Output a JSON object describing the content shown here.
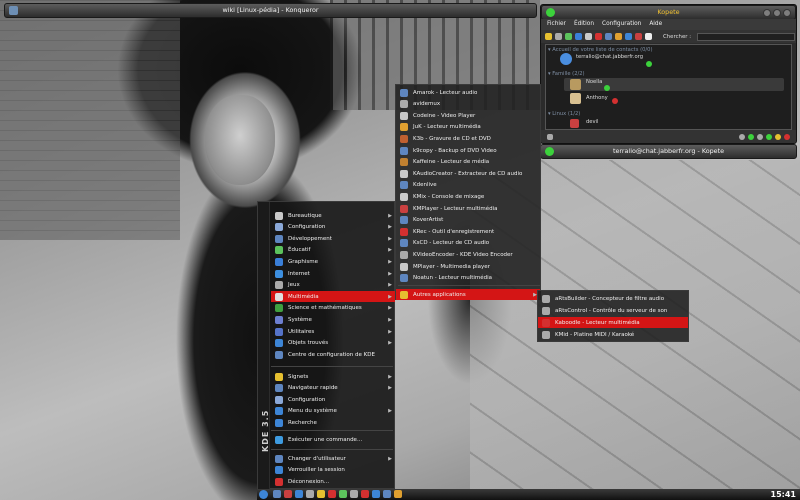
{
  "konqueror": {
    "title": "wiki [Linux-pédia] - Konqueror"
  },
  "kopete": {
    "title": "Kopete",
    "menu": [
      "Fichier",
      "Édition",
      "Configuration",
      "Aide"
    ],
    "search_label": "Chercher :",
    "contacts": [
      {
        "label": "Accueil de votre liste de contacts (0/0)",
        "type": "group"
      },
      {
        "label": "terralio@chat.jabberfr.org",
        "type": "contact"
      },
      {
        "label": "Famille (2/2)",
        "type": "group"
      },
      {
        "label": "Noella",
        "type": "contact"
      },
      {
        "label": "Anthony",
        "type": "contact"
      },
      {
        "label": "Linux (1/2)",
        "type": "group"
      },
      {
        "label": "devil",
        "type": "contact"
      }
    ],
    "colors": {
      "accent": "#f0c030",
      "status_green": "#3cd23c"
    }
  },
  "chat": {
    "title": "terralio@chat.jabberfr.org - Kopete"
  },
  "kmenu": {
    "brand": "KDE 3.5",
    "categories": [
      {
        "label": "Bureautique",
        "icon": "office-icon",
        "color": "#c9c9c9"
      },
      {
        "label": "Configuration",
        "icon": "wrench-icon",
        "color": "#8aa8d8"
      },
      {
        "label": "Développement",
        "icon": "gear-icon",
        "color": "#5e86c0"
      },
      {
        "label": "Éducatif",
        "icon": "education-icon",
        "color": "#5cc35c"
      },
      {
        "label": "Graphisme",
        "icon": "paint-icon",
        "color": "#3a7fd8"
      },
      {
        "label": "Internet",
        "icon": "globe-icon",
        "color": "#3d8fe0"
      },
      {
        "label": "Jeux",
        "icon": "games-icon",
        "color": "#aaaaaa"
      },
      {
        "label": "Multimédia",
        "icon": "multimedia-icon",
        "color": "#e0e0e0"
      },
      {
        "label": "Science et mathématiques",
        "icon": "science-icon",
        "color": "#40a040"
      },
      {
        "label": "Système",
        "icon": "system-icon",
        "color": "#6d7fd1"
      },
      {
        "label": "Utilitaires",
        "icon": "utilities-icon",
        "color": "#5573c9"
      },
      {
        "label": "Objets trouvés",
        "icon": "lost-found-icon",
        "color": "#3d85d6"
      },
      {
        "label": "Centre de configuration de KDE",
        "icon": "kcontrol-icon",
        "color": "#5e86c0"
      }
    ],
    "actions": [
      {
        "label": "Signets",
        "icon": "bookmark-icon",
        "color": "#e6c030"
      },
      {
        "label": "Navigateur rapide",
        "icon": "quickbrowser-icon",
        "color": "#5e86c0"
      },
      {
        "label": "Configuration",
        "icon": "wrench-icon",
        "color": "#8aa8d8"
      },
      {
        "label": "Menu du système",
        "icon": "computer-icon",
        "color": "#3d85d6"
      },
      {
        "label": "Recherche",
        "icon": "search-icon",
        "color": "#3d85d6"
      }
    ],
    "run": {
      "label": "Exécuter une commande...",
      "icon": "run-icon",
      "color": "#3d9be0"
    },
    "session": [
      {
        "label": "Changer d'utilisateur",
        "icon": "switch-user-icon",
        "color": "#5e86c0"
      },
      {
        "label": "Verrouiller la session",
        "icon": "lock-icon",
        "color": "#3d85d6"
      },
      {
        "label": "Déconnexion...",
        "icon": "logout-icon",
        "color": "#d43030"
      }
    ]
  },
  "multimedia_menu": [
    {
      "label": "Amarok - Lecteur audio",
      "color": "#5e86c0"
    },
    {
      "label": "avidemux",
      "color": "#aaaaaa"
    },
    {
      "label": "Codeine - Video Player",
      "color": "#c9c9c9"
    },
    {
      "label": "JuK - Lecteur multimédia",
      "color": "#e0a030"
    },
    {
      "label": "K3b - Gravure de CD et DVD",
      "color": "#c06030"
    },
    {
      "label": "k9copy - Backup of DVD Video",
      "color": "#5e86c0"
    },
    {
      "label": "Kaffeine - Lecteur de média",
      "color": "#c08030"
    },
    {
      "label": "KAudioCreator - Extracteur de CD audio",
      "color": "#c9c9c9"
    },
    {
      "label": "Kdenlive",
      "color": "#5e86c0"
    },
    {
      "label": "KMix - Console de mixage",
      "color": "#c9c9c9"
    },
    {
      "label": "KMPlayer - Lecteur multimédia",
      "color": "#c94040"
    },
    {
      "label": "KoverArtist",
      "color": "#5e86c0"
    },
    {
      "label": "KRec - Outil d'enregistrement",
      "color": "#d43030"
    },
    {
      "label": "KsCD - Lecteur de CD audio",
      "color": "#5e86c0"
    },
    {
      "label": "KVideoEncoder - KDE Video Encoder",
      "color": "#aaaaaa"
    },
    {
      "label": "MPlayer - Multimedia player",
      "color": "#c9c9c9"
    },
    {
      "label": "Noatun - Lecteur multimédia",
      "color": "#5e86c0"
    },
    {
      "label": "Autres applications",
      "color": "#e6c030"
    }
  ],
  "other_apps_menu": [
    {
      "label": "aRtsBuilder - Concepteur de filtre audio",
      "color": "#aaaaaa"
    },
    {
      "label": "aRtsControl - Contrôle du serveur de son",
      "color": "#aaaaaa"
    },
    {
      "label": "Kaboodle - Lecteur multimédia",
      "color": "#d43030"
    },
    {
      "label": "KMid - Platine MIDI / Karaoké",
      "color": "#aaaaaa"
    }
  ],
  "taskbar": {
    "clock": "15:41"
  }
}
